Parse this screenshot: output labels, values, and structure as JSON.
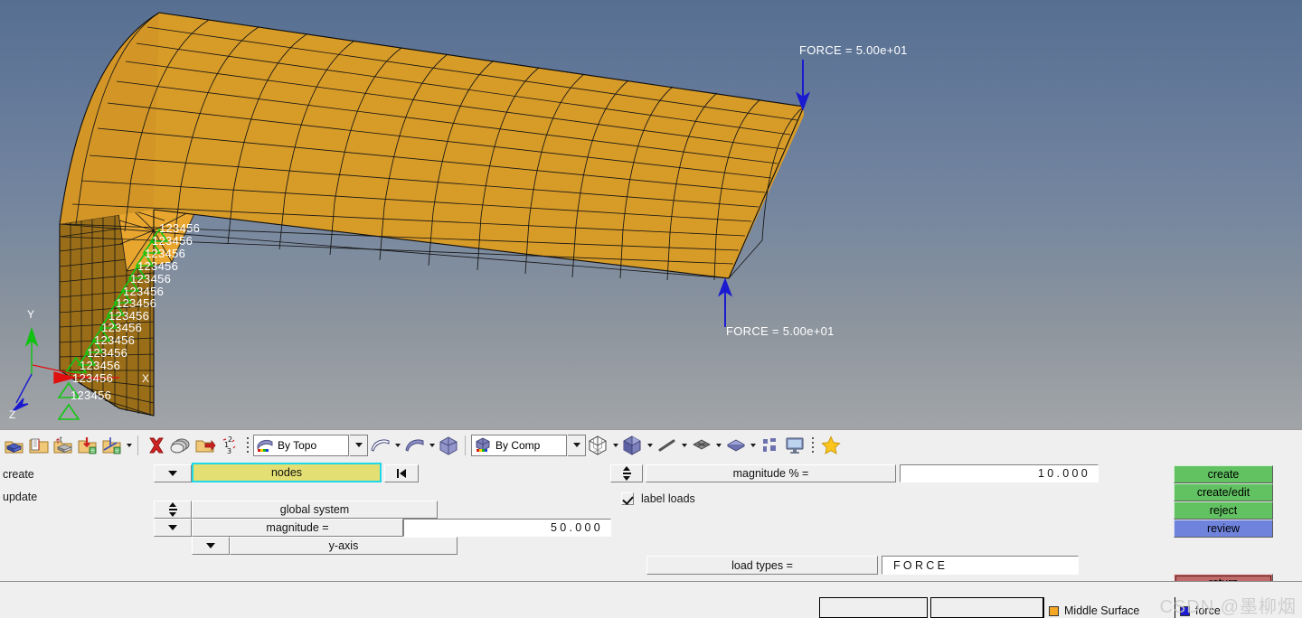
{
  "viewport": {
    "background_top": "#566f91",
    "background_bottom": "#a2a5a8",
    "mesh_color": "#d79b28",
    "mesh_edge_color": "#111111",
    "force_arrow_color": "#1a1ad0",
    "constraint_color": "#11c211",
    "annotations": {
      "force_top": "FORCE = 5.00e+01",
      "force_bottom": "FORCE = 5.00e+01",
      "constraint_dof": "123456"
    },
    "axis_triad": {
      "x_label": "X",
      "y_label": "Y",
      "z_label": "Z",
      "x_color": "#e01010",
      "y_color": "#11c211",
      "z_color": "#1a1ad0"
    },
    "constraint_labels": [
      "123456",
      "123456",
      "123456",
      "123456",
      "123456",
      "123456",
      "123456",
      "123456",
      "123456",
      "123456",
      "123456",
      "123456",
      "123456"
    ]
  },
  "toolbar": {
    "buttons": [
      {
        "name": "component-create-icon",
        "tip": "Create Component"
      },
      {
        "name": "component-import-icon",
        "tip": "Component Table"
      },
      {
        "name": "component-thickness-icon",
        "tip": "Assign Thickness"
      },
      {
        "name": "component-assign-icon",
        "tip": "Organize"
      },
      {
        "name": "component-axis-icon",
        "tip": "Systems"
      }
    ],
    "delete_icon_label": "delete-icon",
    "mask_icon_label": "mask-icon",
    "find_icon_label": "find-icon",
    "numbers_icon_label": "numbers-icon",
    "selector_topo": "By Topo",
    "selector_comp": "By Comp",
    "star_icon_label": "favorites-icon"
  },
  "panel": {
    "mode_labels": [
      "create",
      "update"
    ],
    "entity_selector": {
      "value": "nodes",
      "dropdown_name": "entity-type-dropdown",
      "reset_name": "reset-selection-button"
    },
    "system_row": {
      "label": "global system",
      "toggle_name": "system-toggle"
    },
    "magnitude_row": {
      "label": "magnitude =",
      "value": "50.000"
    },
    "direction_row": {
      "label": "y-axis"
    },
    "magnitude_percent_row": {
      "label": "magnitude % =",
      "value": "10.000"
    },
    "label_loads": {
      "label": "label loads",
      "checked": true
    },
    "load_types_row": {
      "label": "load types =",
      "value": "FORCE"
    },
    "action_buttons": [
      {
        "label": "create",
        "style": "green",
        "name": "create-button"
      },
      {
        "label": "create/edit",
        "style": "green",
        "name": "create-edit-button"
      },
      {
        "label": "reject",
        "style": "green",
        "name": "reject-button"
      },
      {
        "label": "review",
        "style": "blue",
        "name": "review-button"
      }
    ],
    "return_button": {
      "label": "return",
      "style": "red",
      "name": "return-button"
    }
  },
  "statusbar": {
    "legend": [
      {
        "label": "Middle Surface",
        "color": "#f5a623"
      },
      {
        "label": "force",
        "color": "#1a1ad0"
      }
    ],
    "watermark": "CSDN @墨柳烟"
  }
}
